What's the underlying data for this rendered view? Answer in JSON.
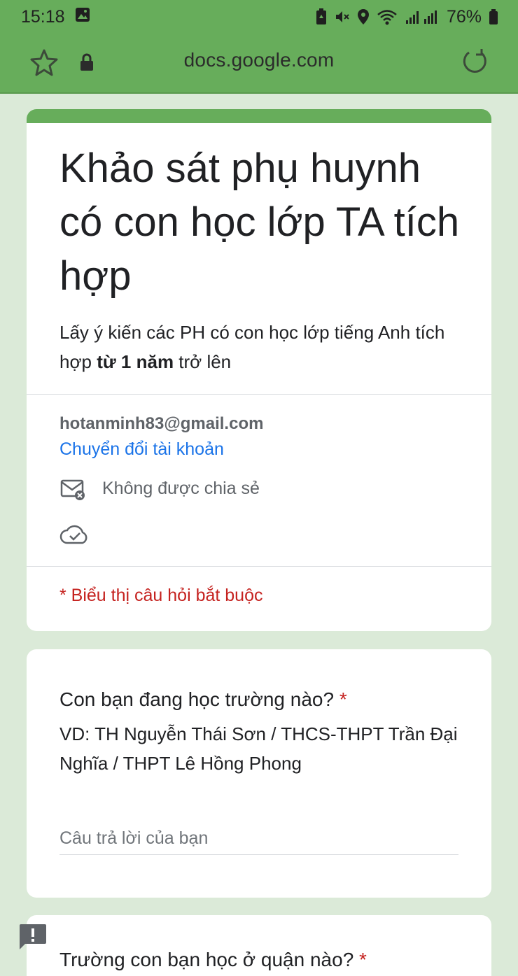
{
  "status_bar": {
    "time": "15:18",
    "battery": "76%"
  },
  "browser": {
    "url": "docs.google.com"
  },
  "form": {
    "title": "Khảo sát phụ huynh có con học lớp TA tích hợp",
    "description_part1": "Lấy ý kiến các PH có con học lớp tiếng Anh tích hợp ",
    "description_bold": "từ 1 năm",
    "description_part2": " trở lên",
    "account_email": "hotanminh83@gmail.com",
    "switch_account": "Chuyển đổi tài khoản",
    "not_shared": "Không được chia sẻ",
    "required_note": "* Biểu thị câu hỏi bắt buộc"
  },
  "questions": [
    {
      "title": "Con bạn đang học trường nào?",
      "required_mark": "*",
      "help_text": "VD: TH Nguyễn Thái Sơn / THCS-THPT Trần Đại Nghĩa / THPT Lê Hồng Phong",
      "placeholder": "Câu trả lời của bạn"
    },
    {
      "title": "Trường con bạn học ở quận nào?",
      "required_mark": "*"
    }
  ],
  "colors": {
    "accent": "#67ad5b",
    "background": "#dbead8",
    "link": "#1a73e8",
    "required": "#c5221f"
  },
  "icons": [
    "image-icon",
    "battery-saver-icon",
    "mute-icon",
    "location-icon",
    "wifi-icon",
    "signal-icon",
    "battery-icon",
    "star-icon",
    "lock-icon",
    "reload-icon",
    "mail-not-shared-icon",
    "cloud-done-icon",
    "feedback-icon"
  ]
}
